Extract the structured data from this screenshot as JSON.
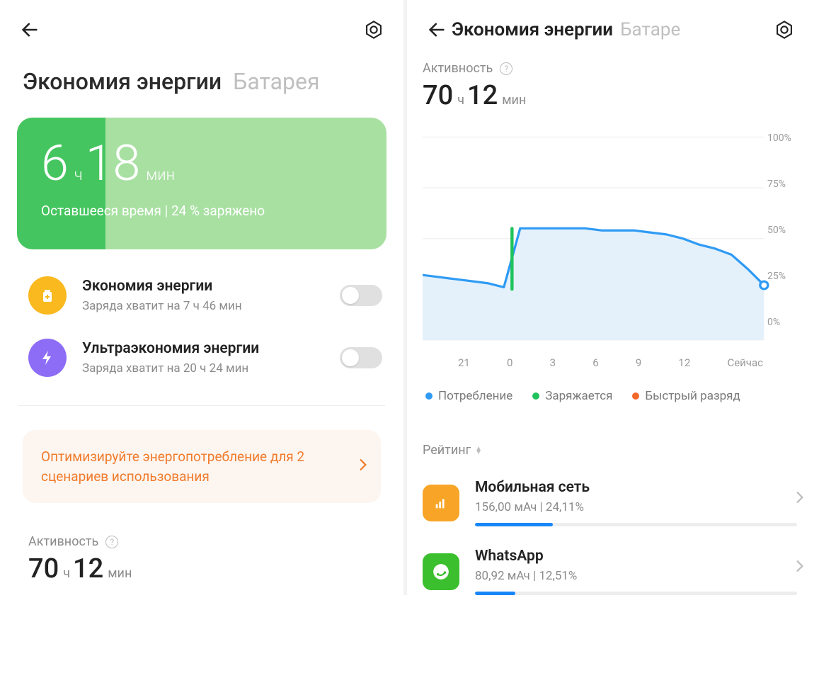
{
  "left": {
    "tabs": {
      "active": "Экономия энергии",
      "inactive": "Батарея"
    },
    "battery_card": {
      "hours": "6",
      "h_unit": "ч",
      "mins": "18",
      "m_unit": "мин",
      "sub": "Оставшееся время | 24 % заряжено",
      "percent": 24
    },
    "saver": {
      "title": "Экономия энергии",
      "sub": "Заряда хватит на 7 ч 46 мин"
    },
    "ultra": {
      "title": "Ультраэкономия энергии",
      "sub": "Заряда хватит на 20 ч 24 мин"
    },
    "optimize": "Оптимизируйте энергопотребление для 2 сценариев использования",
    "activity": {
      "label": "Активность",
      "hours": "70",
      "h_unit": "ч",
      "mins": "12",
      "m_unit": "мин"
    }
  },
  "right": {
    "tabs": {
      "active": "Экономия энергии",
      "inactive": "Батаре"
    },
    "activity": {
      "label": "Активность",
      "hours": "70",
      "h_unit": "ч",
      "mins": "12",
      "m_unit": "мин"
    },
    "chart": {
      "ylabels": [
        "100%",
        "75%",
        "50%",
        "25%",
        "0%"
      ],
      "xlabels": [
        "21",
        "0",
        "3",
        "6",
        "9",
        "12",
        "Сейчас"
      ]
    },
    "legend": {
      "consumption": "Потребление",
      "charging": "Заряжается",
      "fast": "Быстрый разряд"
    },
    "rating_label": "Рейтинг",
    "apps": [
      {
        "name": "Мобильная сеть",
        "detail": "156,00 мАч | 24,11%",
        "pct": 24.11,
        "icon": "mobile"
      },
      {
        "name": "WhatsApp",
        "detail": "80,92 мАч | 12,51%",
        "pct": 12.51,
        "icon": "whatsapp"
      }
    ]
  },
  "chart_data": {
    "type": "line",
    "title": "",
    "xlabel": "",
    "ylabel": "",
    "ylim": [
      0,
      100
    ],
    "x": [
      "18",
      "19",
      "20",
      "21",
      "22",
      "23",
      "0",
      "1",
      "2",
      "3",
      "4",
      "5",
      "6",
      "7",
      "8",
      "9",
      "10",
      "11",
      "12",
      "13",
      "14",
      "Сейчас"
    ],
    "series": [
      {
        "name": "Потребление",
        "color": "#2f9bf4",
        "values": [
          32,
          31,
          30,
          29,
          28,
          26,
          55,
          55,
          55,
          55,
          55,
          54,
          54,
          54,
          53,
          52,
          50,
          47,
          45,
          42,
          35,
          27
        ]
      },
      {
        "name": "Заряжается",
        "color": "#1ec35c",
        "segments": [
          [
            25,
            55
          ]
        ],
        "x_segment": [
          "23",
          "0"
        ]
      },
      {
        "name": "Быстрый разряд",
        "color": "#f4662a",
        "values": []
      }
    ],
    "current_point": {
      "x": "Сейчас",
      "y": 27
    }
  }
}
